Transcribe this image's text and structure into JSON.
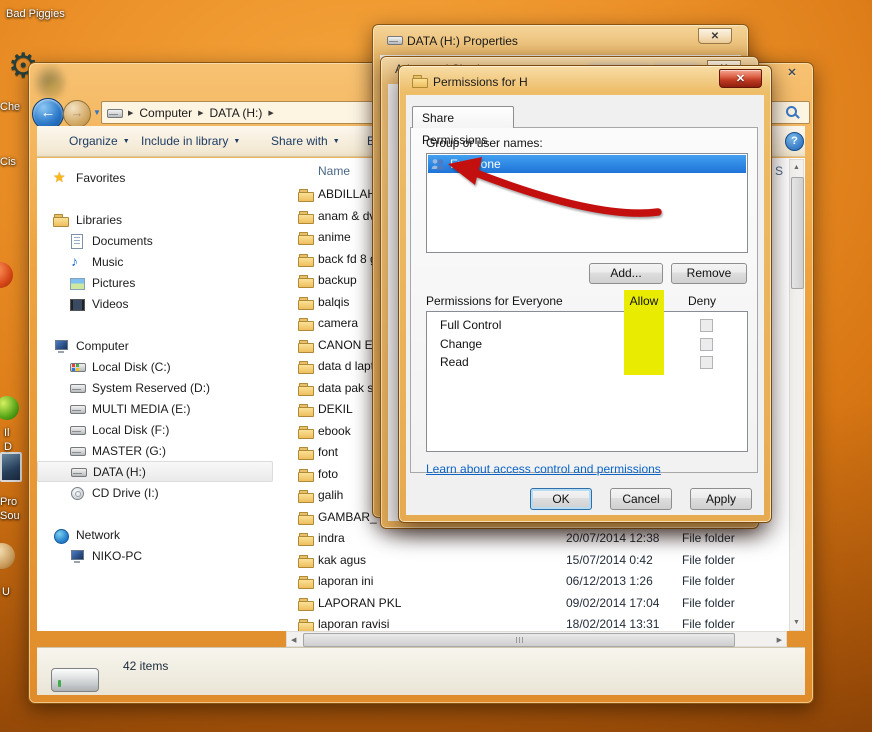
{
  "desktop": {
    "labels": {
      "bad_piggies": "Bad Piggies",
      "che": "Che",
      "cis": "Cis",
      "frag_i": "Il",
      "frag_d": "D",
      "pro": "Pro",
      "sou": "Sou",
      "u": "U"
    }
  },
  "explorer": {
    "breadcrumb": [
      "Computer",
      "DATA (H:)"
    ],
    "toolbar": {
      "organize": "Organize",
      "include_in_library": "Include in library",
      "share_with": "Share with",
      "burn_partial": "B"
    },
    "sidebar": {
      "selected": "DATA (H:)",
      "sections": [
        {
          "label": "Favorites",
          "icon": "star-icon",
          "children": []
        },
        {
          "label": "Libraries",
          "icon": "folder-icon",
          "children": [
            {
              "label": "Documents",
              "icon": "document-icon"
            },
            {
              "label": "Music",
              "icon": "music-icon"
            },
            {
              "label": "Pictures",
              "icon": "picture-icon"
            },
            {
              "label": "Videos",
              "icon": "video-icon"
            }
          ]
        },
        {
          "label": "Computer",
          "icon": "computer-icon",
          "children": [
            {
              "label": "Local Disk (C:)",
              "icon": "drive-c-icon"
            },
            {
              "label": "System Reserved (D:)",
              "icon": "drive-icon"
            },
            {
              "label": "MULTI MEDIA (E:)",
              "icon": "drive-icon"
            },
            {
              "label": "Local Disk (F:)",
              "icon": "drive-icon"
            },
            {
              "label": "MASTER (G:)",
              "icon": "drive-icon"
            },
            {
              "label": "DATA (H:)",
              "icon": "drive-icon"
            },
            {
              "label": "CD Drive (I:)",
              "icon": "cd-icon"
            }
          ]
        },
        {
          "label": "Network",
          "icon": "network-icon",
          "children": [
            {
              "label": "NIKO-PC",
              "icon": "computer-icon"
            }
          ]
        }
      ]
    },
    "filelist": {
      "name_header": "Name",
      "size_header_partial": "S",
      "rows": [
        {
          "name": "ABDILLAH",
          "date": "",
          "type": ""
        },
        {
          "name": "anam & dv",
          "date": "",
          "type": ""
        },
        {
          "name": "anime",
          "date": "",
          "type": ""
        },
        {
          "name": "back fd 8 g",
          "date": "",
          "type": ""
        },
        {
          "name": "backup",
          "date": "",
          "type": ""
        },
        {
          "name": "balqis",
          "date": "",
          "type": ""
        },
        {
          "name": "camera",
          "date": "",
          "type": ""
        },
        {
          "name": "CANON EO",
          "date": "",
          "type": ""
        },
        {
          "name": "data d lapt",
          "date": "",
          "type": ""
        },
        {
          "name": "data pak si",
          "date": "",
          "type": ""
        },
        {
          "name": "DEKIL",
          "date": "",
          "type": ""
        },
        {
          "name": "ebook",
          "date": "",
          "type": ""
        },
        {
          "name": "font",
          "date": "",
          "type": ""
        },
        {
          "name": "foto",
          "date": "",
          "type": ""
        },
        {
          "name": "galih",
          "date": "",
          "type": ""
        },
        {
          "name": "GAMBAR_",
          "date": "",
          "type": ""
        },
        {
          "name": "indra",
          "date": "20/07/2014 12:38",
          "type": "File folder"
        },
        {
          "name": "kak agus",
          "date": "15/07/2014 0:42",
          "type": "File folder"
        },
        {
          "name": "laporan ini",
          "date": "06/12/2013 1:26",
          "type": "File folder"
        },
        {
          "name": "LAPORAN PKL",
          "date": "09/02/2014 17:04",
          "type": "File folder"
        },
        {
          "name": "laporan ravisi",
          "date": "18/02/2014 13:31",
          "type": "File folder"
        }
      ]
    },
    "statusbar": {
      "items_count": "42 items"
    }
  },
  "properties_dialog": {
    "title": "DATA (H:) Properties"
  },
  "advanced_sharing_dialog": {
    "title": "Advanced Sharing"
  },
  "permissions_dialog": {
    "title": "Permissions for H",
    "tab_label": "Share Permissions",
    "group_label": "Group or user names:",
    "group_items": [
      {
        "name": "Everyone",
        "icon": "users-icon"
      }
    ],
    "add_label": "Add...",
    "remove_label": "Remove",
    "permissions_label": "Permissions for Everyone",
    "allow_header": "Allow",
    "deny_header": "Deny",
    "permissions": [
      {
        "name": "Full Control",
        "allow": true,
        "deny": false
      },
      {
        "name": "Change",
        "allow": true,
        "deny": false
      },
      {
        "name": "Read",
        "allow": true,
        "deny": false
      }
    ],
    "link_label": "Learn about access control and permissions",
    "buttons": {
      "ok": "OK",
      "cancel": "Cancel",
      "apply": "Apply"
    }
  },
  "annotations": {
    "highlight_color": "#e9ec00",
    "arrow_color": "#c40f0f"
  }
}
